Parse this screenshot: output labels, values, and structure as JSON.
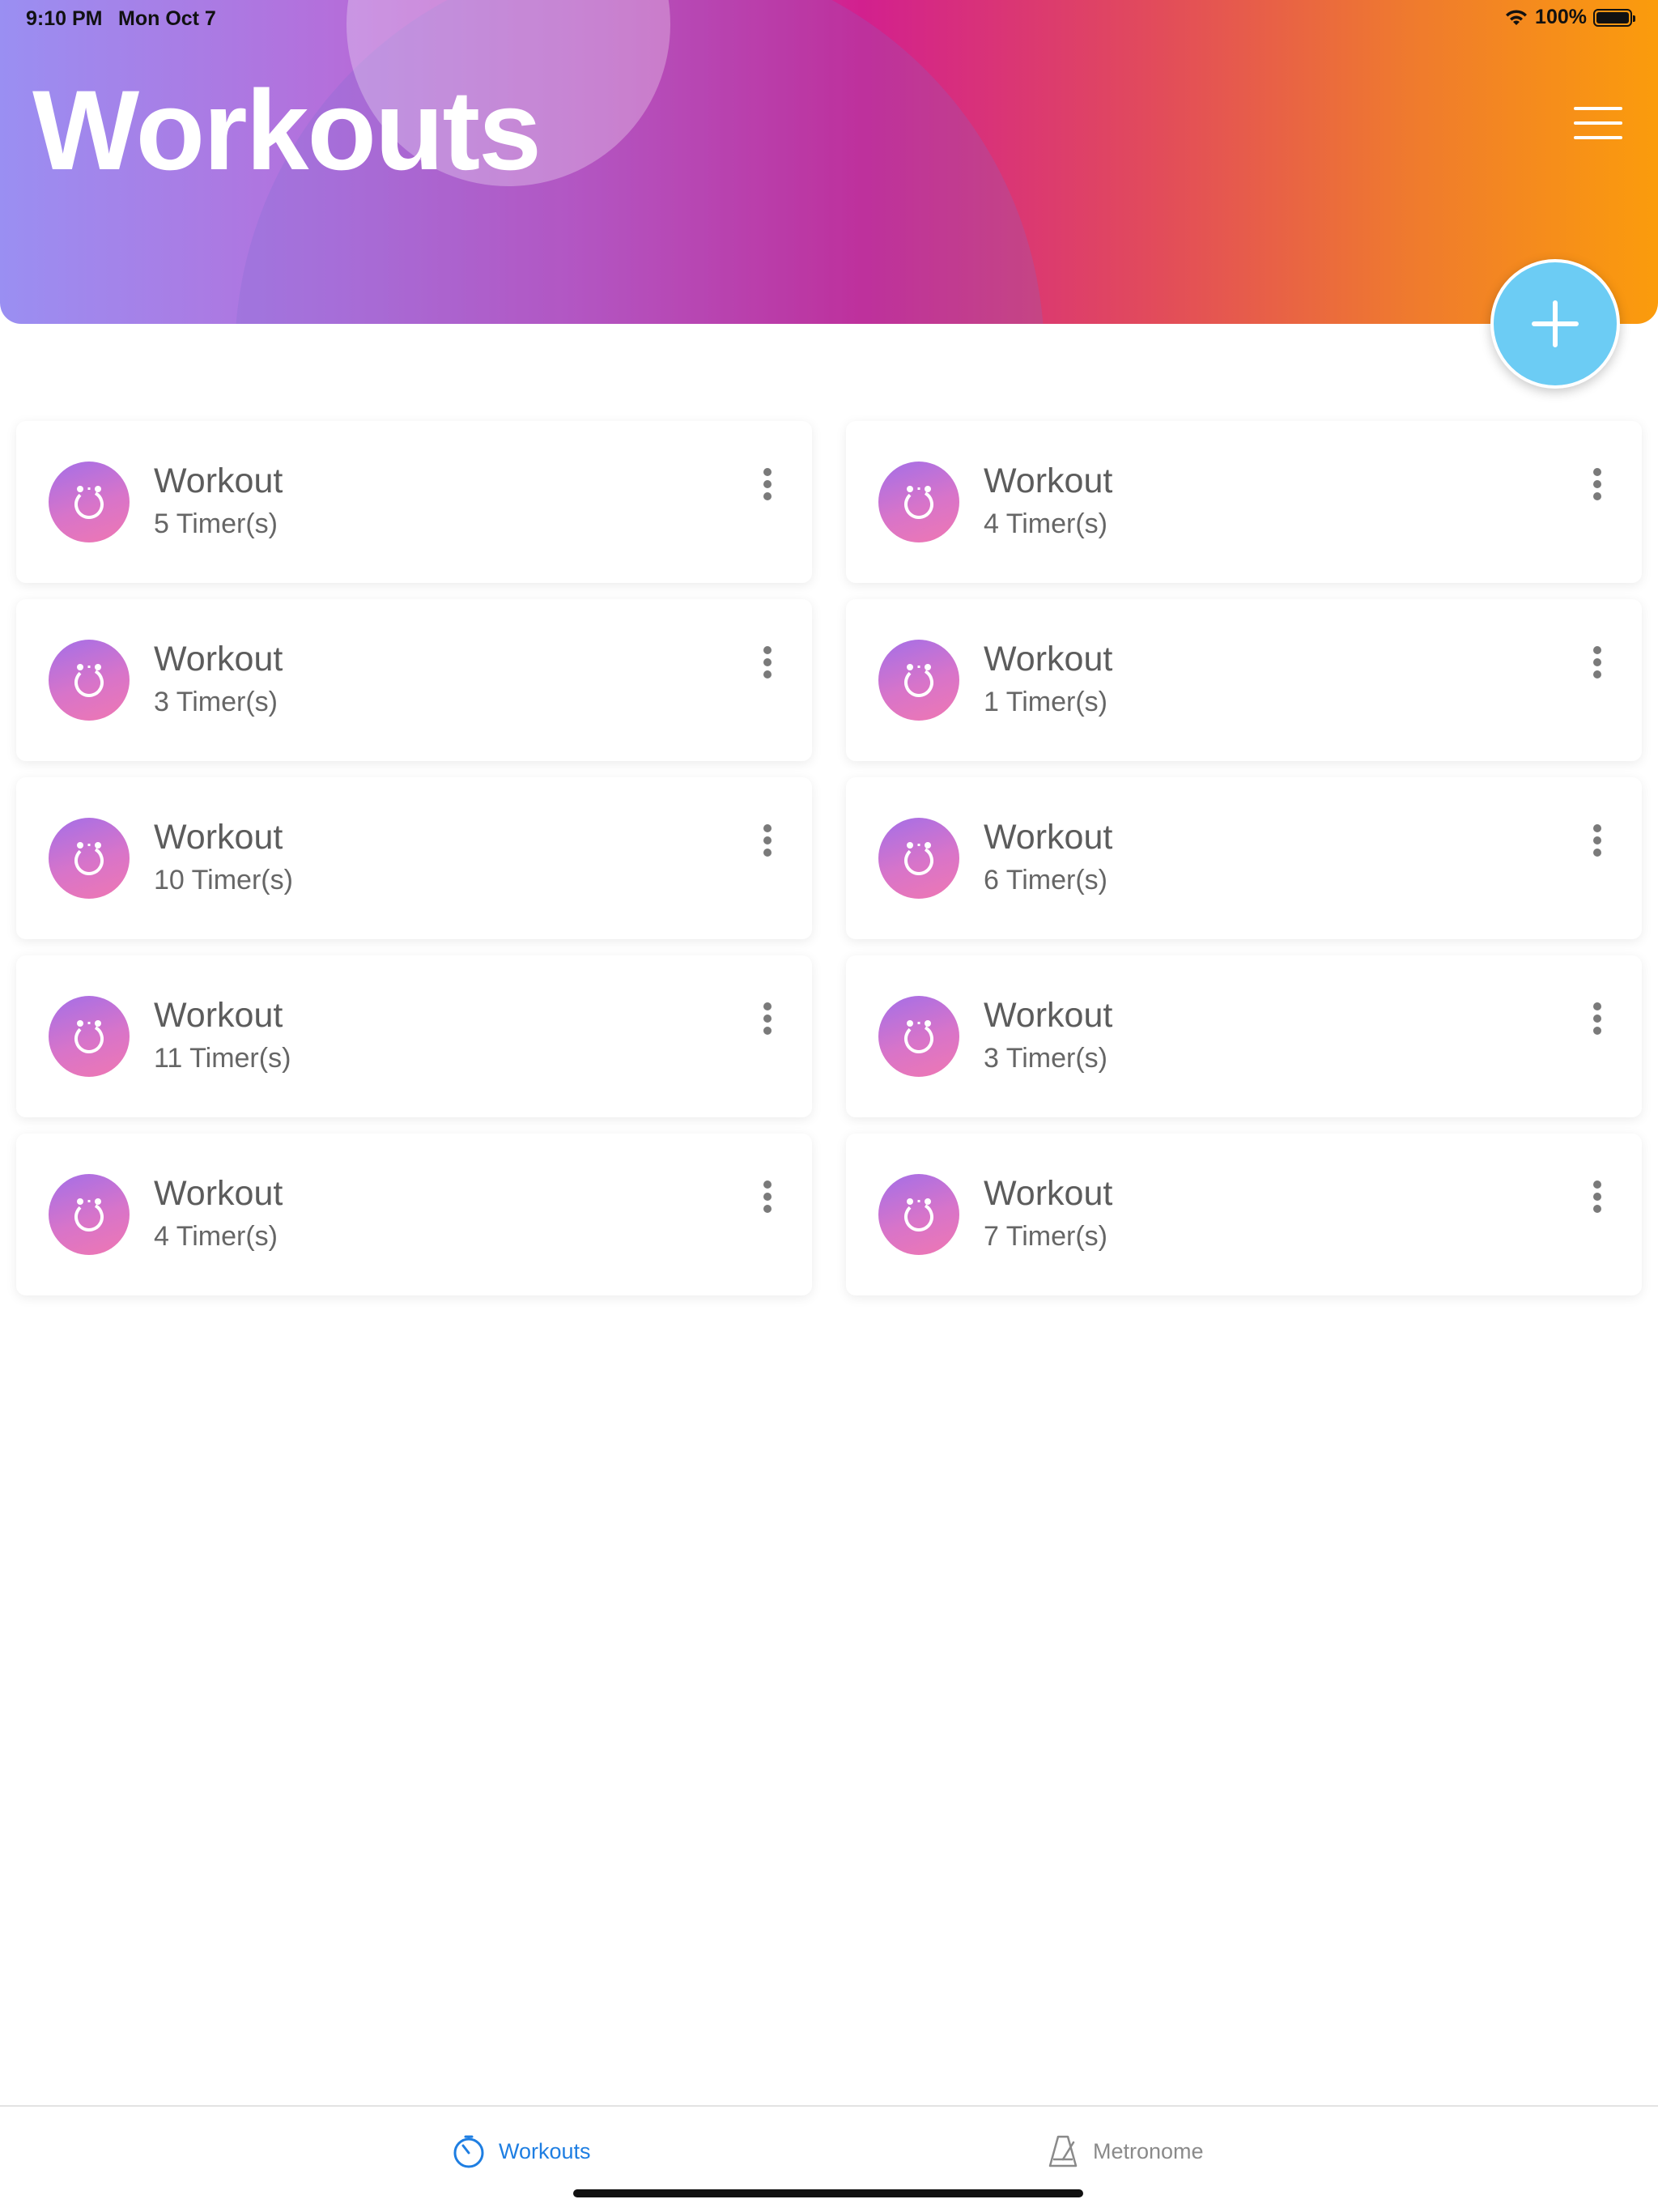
{
  "status_bar": {
    "time": "9:10 PM",
    "date": "Mon Oct 7",
    "battery": "100%"
  },
  "header": {
    "title": "Workouts"
  },
  "colors": {
    "fab": "#6cccf4",
    "tab_active": "#1e7ee2",
    "tab_inactive": "#8a8a8a"
  },
  "workouts": [
    {
      "title": "Workout",
      "subtitle": "5 Timer(s)"
    },
    {
      "title": "Workout",
      "subtitle": "4 Timer(s)"
    },
    {
      "title": "Workout",
      "subtitle": "3 Timer(s)"
    },
    {
      "title": "Workout",
      "subtitle": "1 Timer(s)"
    },
    {
      "title": "Workout",
      "subtitle": "10 Timer(s)"
    },
    {
      "title": "Workout",
      "subtitle": "6 Timer(s)"
    },
    {
      "title": "Workout",
      "subtitle": "11 Timer(s)"
    },
    {
      "title": "Workout",
      "subtitle": "3 Timer(s)"
    },
    {
      "title": "Workout",
      "subtitle": "4 Timer(s)"
    },
    {
      "title": "Workout",
      "subtitle": "7 Timer(s)"
    }
  ],
  "tabs": [
    {
      "label": "Workouts",
      "icon": "timer-icon",
      "active": true
    },
    {
      "label": "Metronome",
      "icon": "metronome-icon",
      "active": false
    }
  ]
}
